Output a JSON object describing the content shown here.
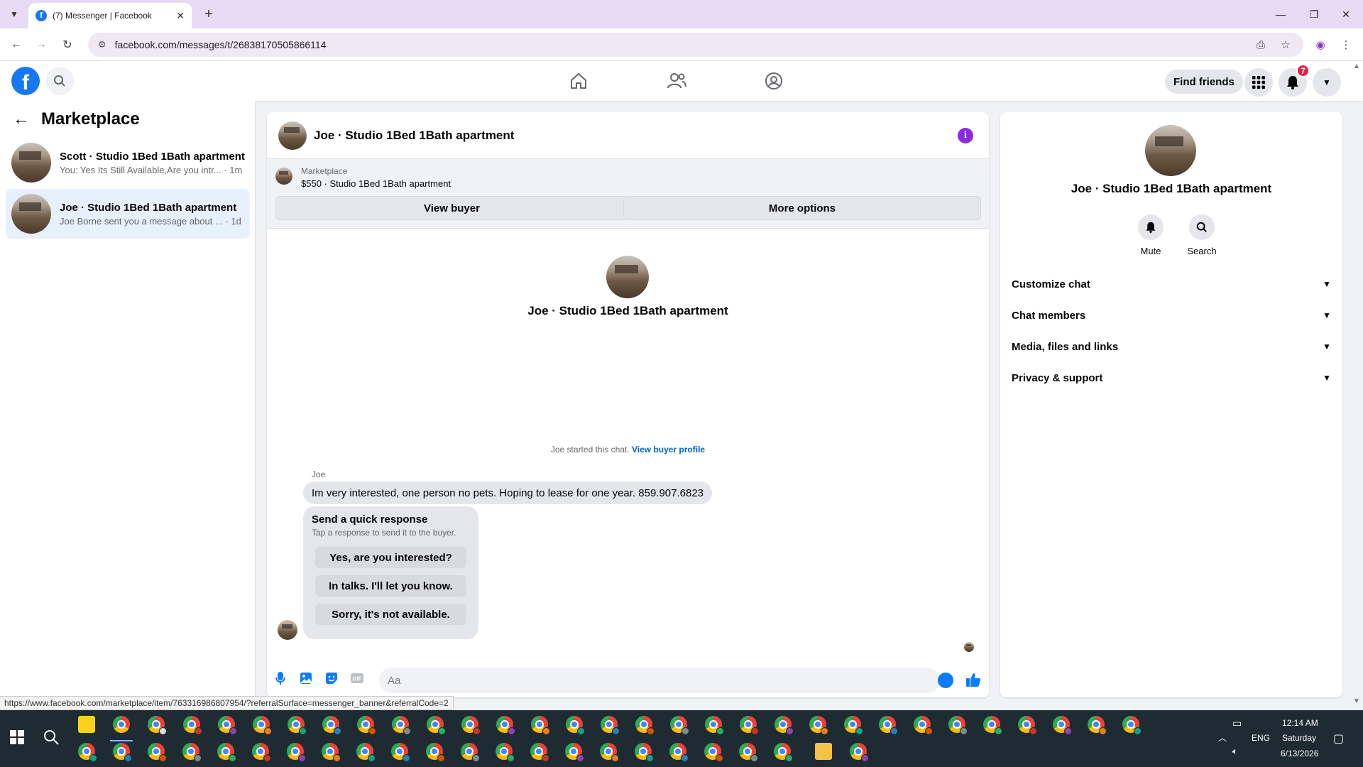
{
  "browser": {
    "tab_title": "(7) Messenger | Facebook",
    "url": "facebook.com/messages/t/26838170505866114",
    "status_url": "https://www.facebook.com/marketplace/item/763316986807954/?referralSurface=messenger_banner&referralCode=2"
  },
  "header": {
    "find_friends": "Find friends",
    "notification_count": "7"
  },
  "sidebar": {
    "title": "Marketplace",
    "conversations": [
      {
        "name": "Scott · Studio 1Bed 1Bath apartment",
        "preview": "You: Yes Its Still Available,Are you intr...",
        "time": "1m"
      },
      {
        "name": "Joe · Studio 1Bed 1Bath apartment",
        "preview": "Joe Borne sent you a message about ...",
        "time": "1d"
      }
    ]
  },
  "chat": {
    "title": "Joe · Studio 1Bed 1Bath apartment",
    "banner_label": "Marketplace",
    "banner_listing": "$550 · Studio 1Bed 1Bath apartment",
    "view_buyer": "View buyer",
    "more_options": "More options",
    "intro_name": "Joe · Studio 1Bed 1Bath apartment",
    "started_text": "Joe started this chat.",
    "view_buyer_profile": "View buyer profile",
    "sender": "Joe",
    "message": "Im very interested, one person no pets. Hoping to lease for one year. 859.907.6823",
    "quick_title": "Send a quick response",
    "quick_sub": "Tap a response to send it to the buyer.",
    "quick_responses": [
      "Yes, are you interested?",
      "In talks. I'll let you know.",
      "Sorry, it's not available."
    ],
    "composer_placeholder": "Aa"
  },
  "info_panel": {
    "name": "Joe · Studio 1Bed 1Bath apartment",
    "mute": "Mute",
    "search": "Search",
    "sections": [
      "Customize chat",
      "Chat members",
      "Media, files and links",
      "Privacy & support"
    ]
  },
  "taskbar": {
    "language": "ENG",
    "time": "12:14 AM",
    "day": "Saturday",
    "date": "6/13/2026"
  },
  "colors": {
    "facebook_blue": "#1877f2",
    "active_conversation": "#e7f0fd",
    "info_purple": "#8a2be2",
    "notification_red": "#e41e3f"
  }
}
